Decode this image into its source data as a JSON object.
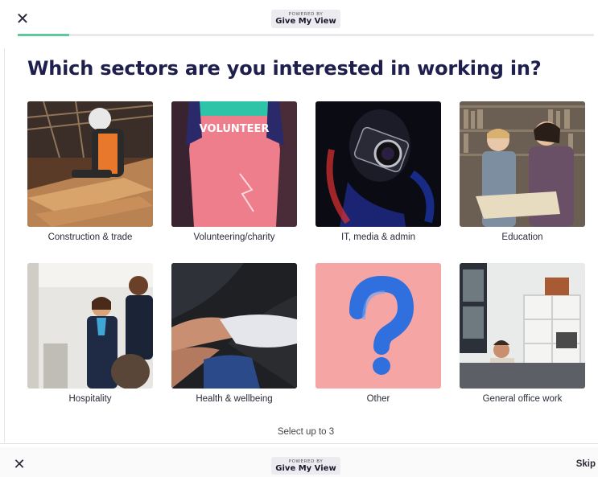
{
  "header": {
    "close_label": "✕",
    "badge_small": "POWERED BY",
    "badge_brand": "Give My View",
    "progress_percent": 9
  },
  "question": "Which sectors are you interested in working in?",
  "sectors": [
    {
      "label": "Construction & trade",
      "icon": "construction-photo"
    },
    {
      "label": "Volunteering/charity",
      "icon": "volunteer-photo",
      "shirt_text": "VOLUNTEER"
    },
    {
      "label": "IT, media & admin",
      "icon": "camera-photo"
    },
    {
      "label": "Education",
      "icon": "education-photo"
    },
    {
      "label": "Hospitality",
      "icon": "hospitality-photo"
    },
    {
      "label": "Health & wellbeing",
      "icon": "health-photo"
    },
    {
      "label": "Other",
      "icon": "question-mark-photo"
    },
    {
      "label": "General office work",
      "icon": "office-photo"
    }
  ],
  "hint": "Select up to 3",
  "footer": {
    "close_label": "✕",
    "badge_small": "POWERED BY",
    "badge_brand": "Give My View",
    "skip_label": "Skip"
  },
  "colors": {
    "heading": "#1f1f4d",
    "progress": "#5fc99a",
    "other_bg": "#f5a6a4",
    "question_mark": "#2f6fde"
  }
}
